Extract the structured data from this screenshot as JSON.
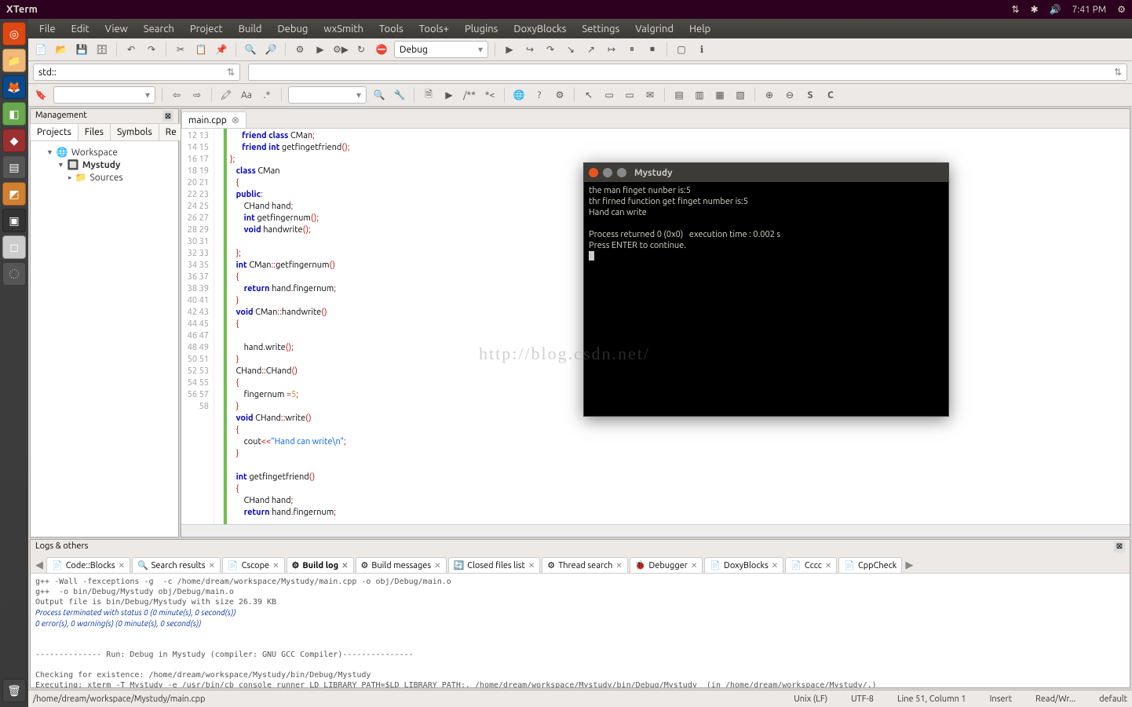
{
  "system": {
    "title": "XTerm",
    "time": "7:41 PM",
    "indicators": [
      "↕↓",
      "✱",
      "🔊"
    ]
  },
  "menubar": [
    "File",
    "Edit",
    "View",
    "Search",
    "Project",
    "Build",
    "Debug",
    "wxSmith",
    "Tools",
    "Tools+",
    "Plugins",
    "DoxyBlocks",
    "Settings",
    "Valgrind",
    "Help"
  ],
  "toolbar2": {
    "combo1": "std::",
    "combo2": "",
    "config": "Debug"
  },
  "mgmt": {
    "title": "Management",
    "tabs": [
      "Projects",
      "Files",
      "Symbols",
      "Re"
    ],
    "active": 0,
    "tree": {
      "root": "Workspace",
      "project": "Mystudy",
      "sources": "Sources"
    }
  },
  "editor": {
    "tab": "main.cpp",
    "line_start": 12,
    "line_end": 58
  },
  "logs": {
    "title": "Logs & others",
    "tabs": [
      "Code::Blocks",
      "Search results",
      "Cscope",
      "Build log",
      "Build messages",
      "Closed files list",
      "Thread search",
      "Debugger",
      "DoxyBlocks",
      "Cccc",
      "CppCheck"
    ],
    "active": 3
  },
  "status": {
    "path": "/home/dream/workspace/Mystudy/main.cpp",
    "eol": "Unix (LF)",
    "enc": "UTF-8",
    "pos": "Line 51, Column 1",
    "ins": "Insert",
    "rw": "Read/Wr...",
    "profile": "default"
  },
  "term": {
    "title": "Mystudy",
    "lines": [
      "the man finget nunber is:5",
      "thr firned function get finget number is:5",
      "Hand can write",
      "",
      "Process returned 0 (0x0)   execution time : 0.002 s",
      "Press ENTER to continue."
    ]
  },
  "watermark": "http://blog.csdn.net/"
}
